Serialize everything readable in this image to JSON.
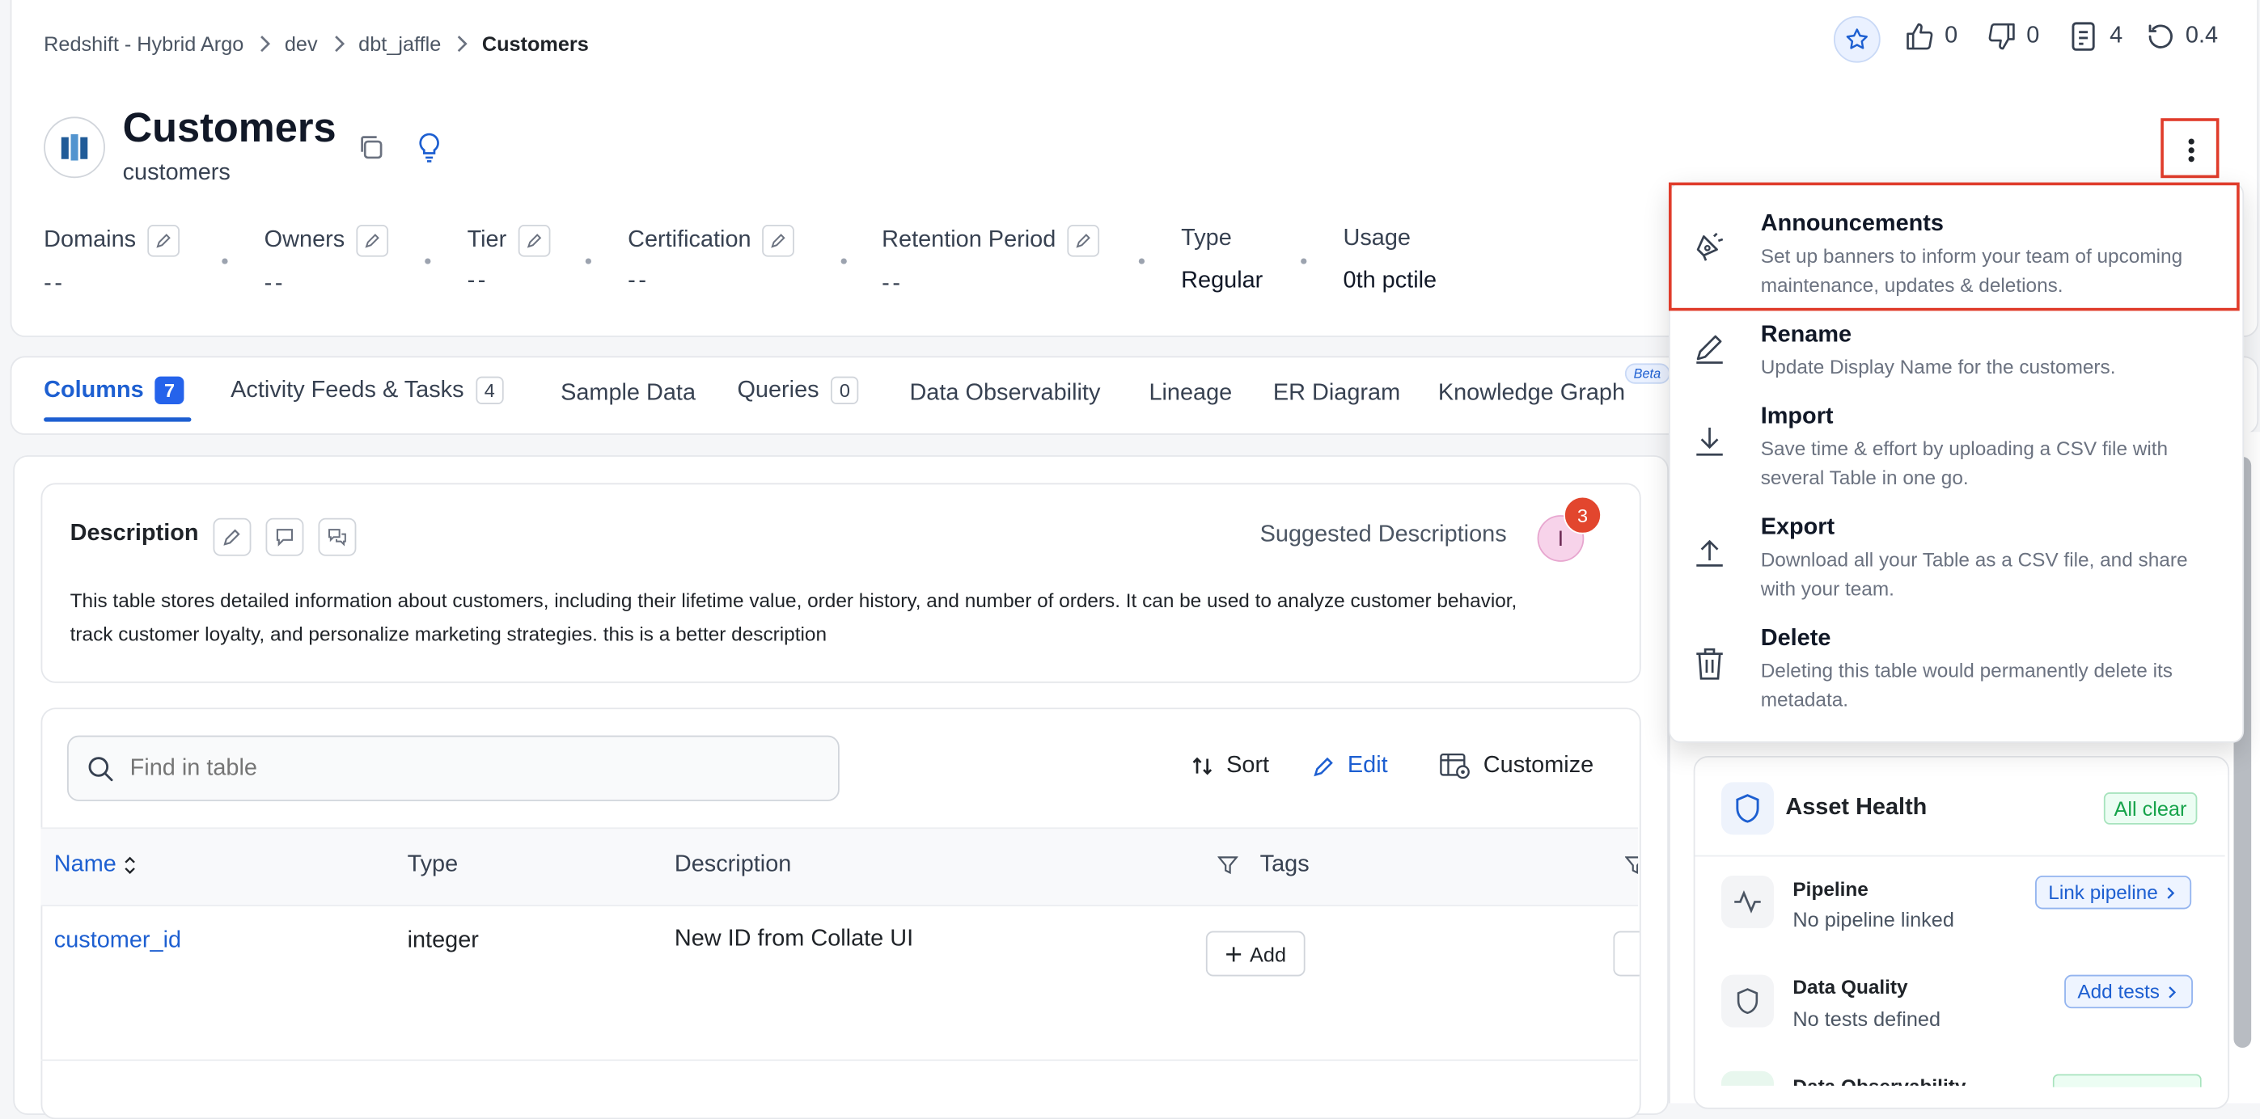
{
  "breadcrumb": [
    "Redshift - Hybrid Argo",
    "dev",
    "dbt_jaffle",
    "Customers"
  ],
  "top_actions": {
    "likes": "0",
    "dislikes": "0",
    "docs": "4",
    "version": "0.4"
  },
  "entity": {
    "title": "Customers",
    "subtitle": "customers"
  },
  "properties": [
    {
      "label": "Domains",
      "value": "--"
    },
    {
      "label": "Owners",
      "value": "--"
    },
    {
      "label": "Tier",
      "value": "--"
    },
    {
      "label": "Certification",
      "value": "--"
    },
    {
      "label": "Retention Period",
      "value": "--"
    },
    {
      "label": "Type",
      "value": "Regular"
    },
    {
      "label": "Usage",
      "value": "0th pctile"
    }
  ],
  "tabs": [
    {
      "label": "Columns",
      "badge": "7"
    },
    {
      "label": "Activity Feeds & Tasks",
      "badge": "4"
    },
    {
      "label": "Sample Data"
    },
    {
      "label": "Queries",
      "badge": "0"
    },
    {
      "label": "Data Observability"
    },
    {
      "label": "Lineage"
    },
    {
      "label": "ER Diagram"
    },
    {
      "label": "Knowledge Graph",
      "tag": "Beta"
    }
  ],
  "description": {
    "title": "Description",
    "suggested_label": "Suggested Descriptions",
    "suggested_count": "3",
    "avatar_letter": "I",
    "text": "This table stores detailed information about customers, including their lifetime value, order history, and number of orders. It can be used to analyze customer behavior, track customer loyalty, and personalize marketing strategies. this is a better description"
  },
  "table": {
    "search_placeholder": "Find in table",
    "sort_label": "Sort",
    "edit_label": "Edit",
    "customize_label": "Customize",
    "columns": [
      "Name",
      "Type",
      "Description",
      "Tags"
    ],
    "rows": [
      {
        "name": "customer_id",
        "type": "integer",
        "description": "New ID from Collate UI",
        "tag_button": "Add"
      }
    ]
  },
  "menu": [
    {
      "title": "Announcements",
      "desc": "Set up banners to inform your team of upcoming maintenance, updates & deletions."
    },
    {
      "title": "Rename",
      "desc": "Update Display Name for the customers."
    },
    {
      "title": "Import",
      "desc": "Save time & effort by uploading a CSV file with several Table in one go."
    },
    {
      "title": "Export",
      "desc": "Download all your Table as a CSV file, and share with your team."
    },
    {
      "title": "Delete",
      "desc": "Deleting this table would permanently delete its metadata."
    }
  ],
  "health": {
    "title": "Asset Health",
    "status": "All clear",
    "items": [
      {
        "title": "Pipeline",
        "desc": "No pipeline linked",
        "action": "Link pipeline"
      },
      {
        "title": "Data Quality",
        "desc": "No tests defined",
        "action": "Add tests"
      },
      {
        "title": "Data Observability"
      }
    ]
  },
  "colors": {
    "accent": "#1d5fd1",
    "highlight": "#e03c2b",
    "badge_bg": "#2563eb",
    "success": "#16a34a"
  }
}
